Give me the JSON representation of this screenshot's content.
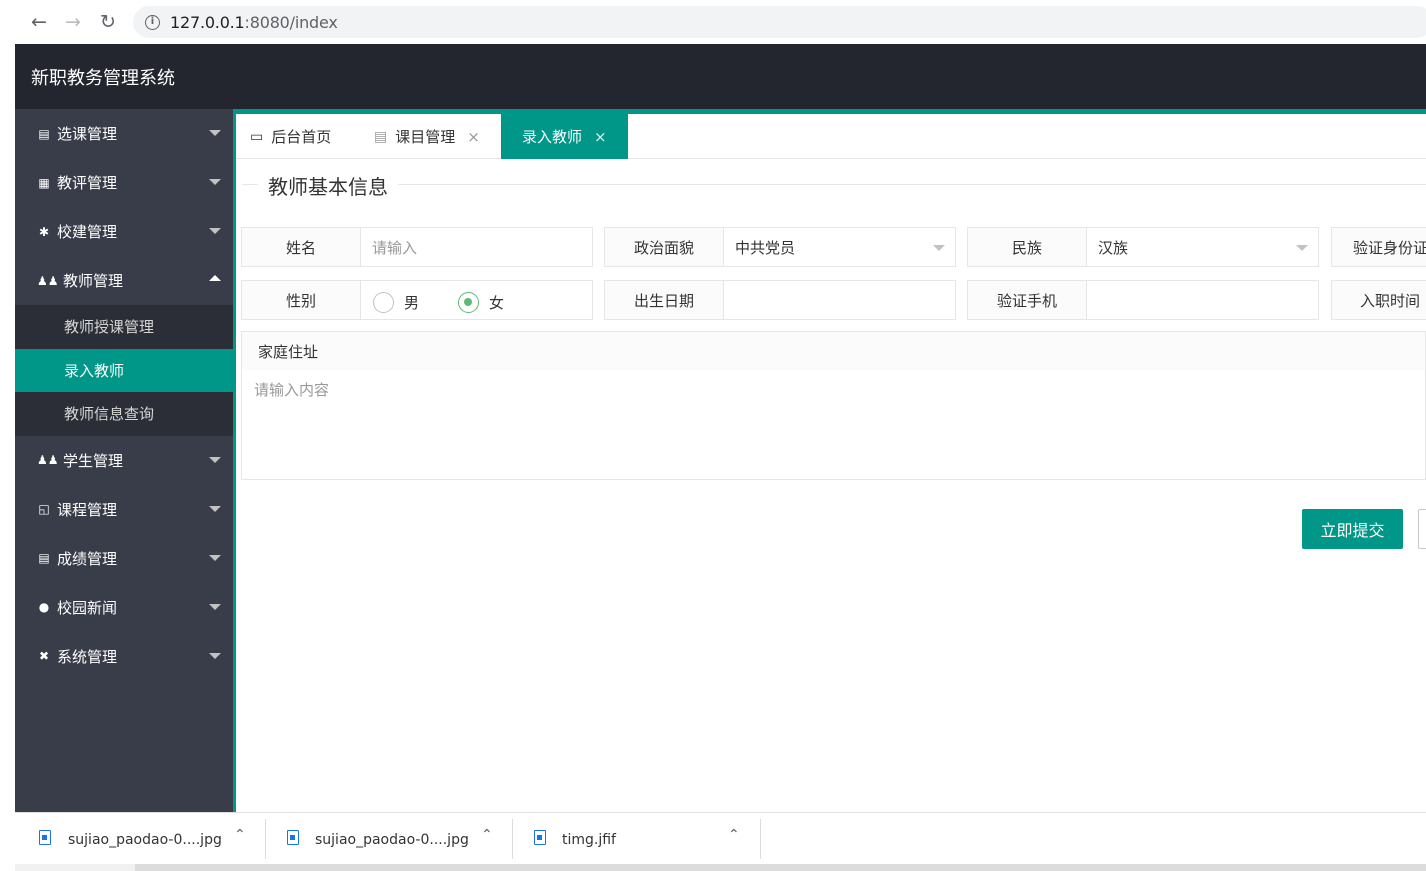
{
  "browser": {
    "url_host": "127.0.0.1",
    "url_path": ":8080/index"
  },
  "app": {
    "title": "新职教务管理系统"
  },
  "sidebar": {
    "items": [
      {
        "label": "选课管理",
        "icon": "document-icon"
      },
      {
        "label": "教评管理",
        "icon": "grid-icon"
      },
      {
        "label": "校建管理",
        "icon": "tree-icon"
      },
      {
        "label": "教师管理",
        "icon": "users-icon",
        "expanded": true
      },
      {
        "label": "学生管理",
        "icon": "users-icon"
      },
      {
        "label": "课程管理",
        "icon": "book-icon"
      },
      {
        "label": "成绩管理",
        "icon": "clipboard-icon"
      },
      {
        "label": "校园新闻",
        "icon": "chat-icon"
      },
      {
        "label": "系统管理",
        "icon": "tools-icon"
      }
    ],
    "teacher_sub": [
      {
        "label": "教师授课管理"
      },
      {
        "label": "录入教师",
        "active": true
      },
      {
        "label": "教师信息查询"
      }
    ]
  },
  "tabs": [
    {
      "label": "后台首页",
      "icon": "monitor-icon"
    },
    {
      "label": "课目管理",
      "icon": "document-icon",
      "close": "×"
    },
    {
      "label": "录入教师",
      "active": true,
      "close": "×"
    }
  ],
  "form": {
    "legend": "教师基本信息",
    "name_label": "姓名",
    "name_placeholder": "请输入",
    "politics_label": "政治面貌",
    "politics_value": "中共党员",
    "ethnic_label": "民族",
    "ethnic_value": "汉族",
    "id_label": "验证身份证",
    "gender_label": "性别",
    "gender_male": "男",
    "gender_female": "女",
    "gender_selected": "女",
    "birth_label": "出生日期",
    "phone_label": "验证手机",
    "hire_label": "入职时间",
    "address_label": "家庭住址",
    "address_placeholder": "请输入内容",
    "submit_label": "立即提交"
  },
  "downloads": [
    {
      "name": "sujiao_paodao-0....jpg"
    },
    {
      "name": "sujiao_paodao-0....jpg"
    },
    {
      "name": "timg.jfif"
    }
  ],
  "colors": {
    "accent": "#009688",
    "header": "#23262e",
    "sidebar": "#393d49",
    "radio_on": "#5fb878"
  }
}
